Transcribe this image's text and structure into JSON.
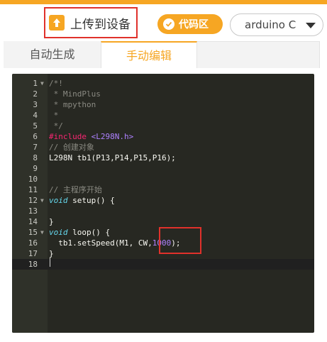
{
  "toolbar": {
    "upload_label": "上传到设备",
    "code_area_label": "代码区",
    "board_select_value": "arduino C"
  },
  "tabs": [
    {
      "label": "自动生成",
      "active": false
    },
    {
      "label": "手动编辑",
      "active": true
    }
  ],
  "colors": {
    "accent": "#f6a623",
    "highlight": "#e0312b",
    "editor_bg": "#272822"
  },
  "editor": {
    "lines": [
      {
        "n": "1",
        "fold": true,
        "code": "/*!"
      },
      {
        "n": "2",
        "fold": false,
        "code": " * MindPlus"
      },
      {
        "n": "3",
        "fold": false,
        "code": " * mpython"
      },
      {
        "n": "4",
        "fold": false,
        "code": " *"
      },
      {
        "n": "5",
        "fold": false,
        "code": " */"
      },
      {
        "n": "6",
        "fold": false,
        "code": "#include <L298N.h>"
      },
      {
        "n": "7",
        "fold": false,
        "code": "// 创建对象"
      },
      {
        "n": "8",
        "fold": false,
        "code": "L298N tb1(P13,P14,P15,P16);"
      },
      {
        "n": "9",
        "fold": false,
        "code": ""
      },
      {
        "n": "10",
        "fold": false,
        "code": ""
      },
      {
        "n": "11",
        "fold": false,
        "code": "// 主程序开始"
      },
      {
        "n": "12",
        "fold": true,
        "code": "void setup() {"
      },
      {
        "n": "13",
        "fold": false,
        "code": ""
      },
      {
        "n": "14",
        "fold": false,
        "code": "}"
      },
      {
        "n": "15",
        "fold": true,
        "code": "void loop() {"
      },
      {
        "n": "16",
        "fold": false,
        "code": "  tb1.setSpeed(M1, CW,1000);"
      },
      {
        "n": "17",
        "fold": false,
        "code": "}"
      },
      {
        "n": "18",
        "fold": false,
        "code": ""
      }
    ]
  }
}
